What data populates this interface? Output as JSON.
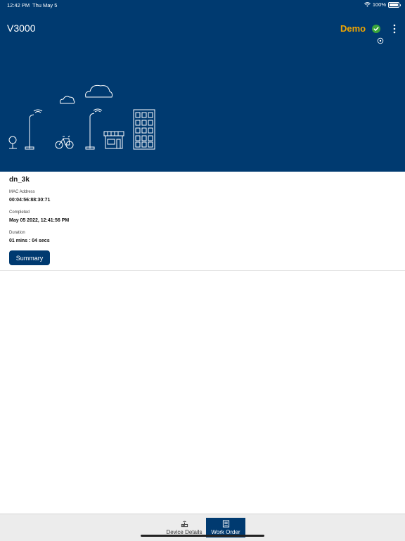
{
  "status_bar": {
    "time": "12:42 PM",
    "date": "Thu May 5",
    "battery": "100%"
  },
  "header": {
    "title": "V3000",
    "mode": "Demo",
    "colors": {
      "background": "#003a70",
      "mode": "#f0a500",
      "check": "#3aa53a"
    },
    "icons": [
      "checkmark-circle-icon",
      "more-vertical-icon",
      "sync-status-icon"
    ]
  },
  "device": {
    "name": "dn_3k",
    "mac_label": "MAC Address",
    "mac_value": "00:04:56:88:30:71",
    "completed_label": "Completed",
    "completed_value": "May 05 2022, 12:41:56 PM",
    "duration_label": "Duration",
    "duration_value": "01 mins : 04 secs",
    "summary_button": "Summary"
  },
  "tabs": [
    {
      "label": "Device Details",
      "icon": "router-icon",
      "selected": false
    },
    {
      "label": "Work Order",
      "icon": "document-list-icon",
      "selected": true
    }
  ]
}
